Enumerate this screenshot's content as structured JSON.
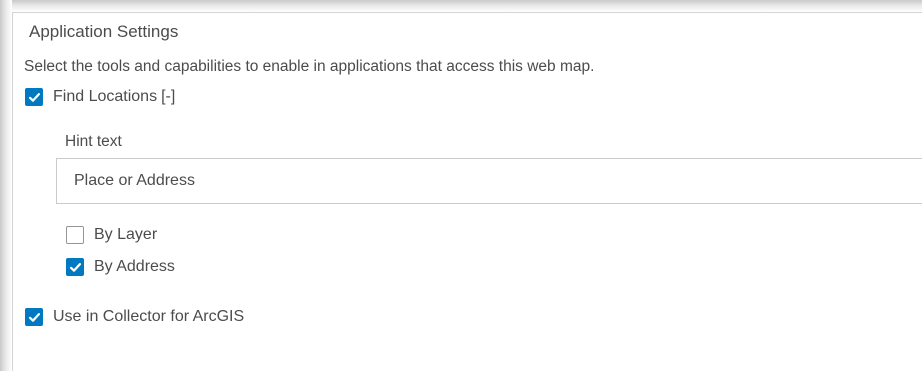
{
  "panel": {
    "title": "Application Settings",
    "description": "Select the tools and capabilities to enable in applications that access this web map."
  },
  "find_locations": {
    "label": "Find Locations",
    "checked": true,
    "collapse_toggle": "[-]",
    "hint_label": "Hint text",
    "hint_value": "Place or Address",
    "options": [
      {
        "label": "By Layer",
        "checked": false
      },
      {
        "label": "By Address",
        "checked": true
      }
    ]
  },
  "collector": {
    "label": "Use in Collector for ArcGIS",
    "checked": true
  },
  "colors": {
    "accent": "#0079c1",
    "text": "#4c4c4c",
    "border": "#cbcbcb"
  },
  "icons": {
    "checkmark": "checkmark-icon"
  }
}
